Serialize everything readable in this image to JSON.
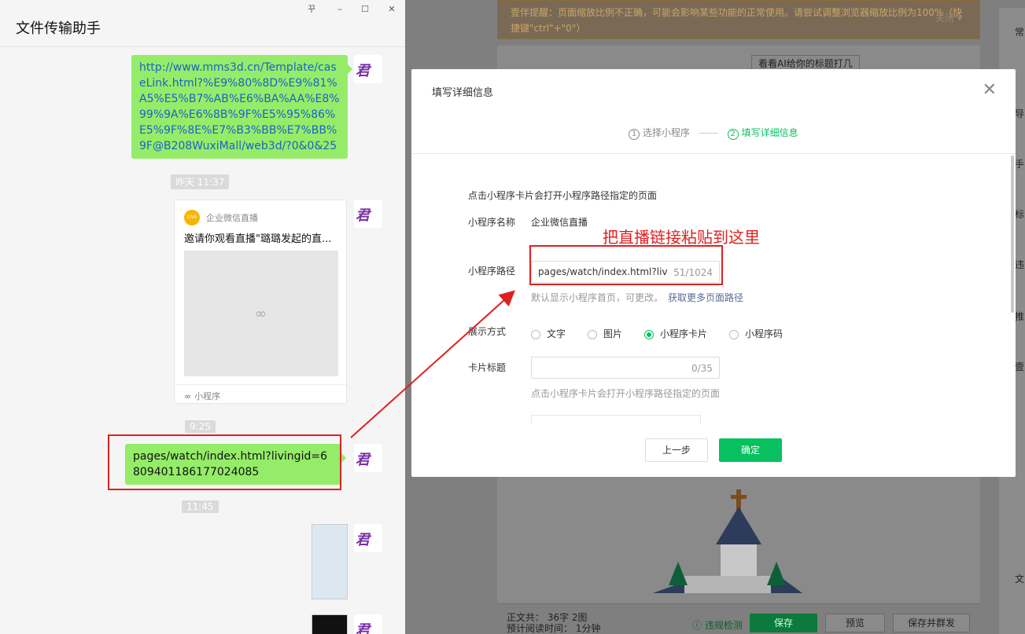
{
  "chat": {
    "title": "文件传输助手",
    "window_controls": [
      "꾸",
      "–",
      "☐",
      "✕"
    ],
    "avatar_text": "君羊",
    "messages": [
      {
        "type": "link",
        "text": "http://www.mms3d.cn/Template/caseLink.html?%E9%80%8D%E9%81%A5%E5%B7%AB%E6%BA%AA%E8%99%9A%E6%8B%9F%E5%95%86%E5%9F%8E%E7%B3%BB%E7%BB%9F@B208WuxiMall/web3d/?0&0&25"
      },
      {
        "type": "time",
        "text": "昨天 11:37"
      },
      {
        "type": "card",
        "source": "企业微信直播",
        "title": "邀请你观看直播\"璐璐发起的直...",
        "footer": "小程序",
        "live_badge": "LIVE"
      },
      {
        "type": "time",
        "text": "9:25"
      },
      {
        "type": "text",
        "text": "pages/watch/index.html?livingid=6809401186177024085"
      },
      {
        "type": "time",
        "text": "11:45"
      }
    ]
  },
  "editor": {
    "notice": "壹伴提醒：页面缩放比例不正确，可能会影响某些功能的正常使用。请尝试调整浏览器缩放比例为100%（快捷键\"ctrl\"+\"0\"）",
    "notice_close": "关闭 ▾",
    "ai_button": "看看AI给你的标题打几",
    "side_chars": [
      "常",
      "导",
      "手",
      "标",
      "违",
      "推",
      "壹",
      "文"
    ],
    "word_count_line1": "正文共： 36字 2图",
    "word_count_line2": "预计阅读时间： 1分钟",
    "detect": "违规检测",
    "save": "保存",
    "preview": "预览",
    "save_mass": "保存并群发"
  },
  "modal": {
    "title": "填写详细信息",
    "close": "✕",
    "steps": [
      {
        "num": "1",
        "label": "选择小程序",
        "active": false
      },
      {
        "num": "2",
        "label": "填写详细信息",
        "active": true
      }
    ],
    "description": "点击小程序卡片会打开小程序路径指定的页面",
    "mp_name_label": "小程序名称",
    "mp_name_value": "企业微信直播",
    "annotation": "把直播链接粘贴到这里",
    "path_label": "小程序路径",
    "path_value": "pages/watch/index.html?livingid=6809401186177024085",
    "path_count": "51/1024",
    "path_hint": "默认显示小程序首页，可更改。",
    "path_hint_link": "获取更多页面路径",
    "display_label": "展示方式",
    "display_options": [
      {
        "label": "文字",
        "checked": false
      },
      {
        "label": "图片",
        "checked": false
      },
      {
        "label": "小程序卡片",
        "checked": true
      },
      {
        "label": "小程序码",
        "checked": false
      }
    ],
    "card_title_label": "卡片标题",
    "card_title_value": "",
    "card_title_count": "0/35",
    "card_hint": "点击小程序卡片会打开小程序路径指定的页面",
    "prev_button": "上一步",
    "ok_button": "确定"
  },
  "colors": {
    "wechat_green": "#07c160",
    "bubble_green": "#95ec69",
    "annotation_red": "#e02020",
    "link_blue": "#576b95"
  }
}
